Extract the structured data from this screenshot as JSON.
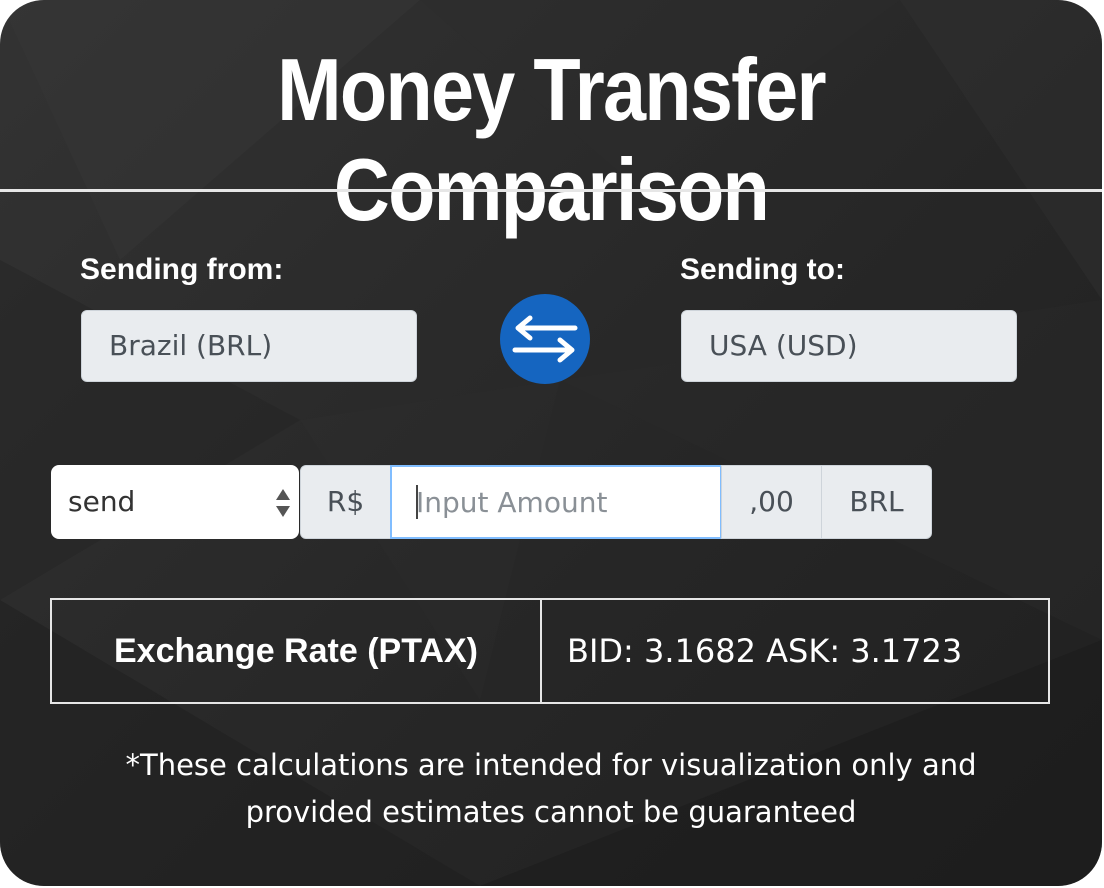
{
  "title": "Money Transfer Comparison",
  "from": {
    "label": "Sending from:",
    "value": "Brazil (BRL)"
  },
  "to": {
    "label": "Sending to:",
    "value": "USA (USD)"
  },
  "swap": {
    "icon": "swap-arrows-icon"
  },
  "amount": {
    "mode": "send",
    "prefix": "R$",
    "placeholder": "Input Amount",
    "decimals": ",00",
    "currency": "BRL"
  },
  "rate": {
    "label": "Exchange Rate (PTAX)",
    "value": "BID: 3.1682 ASK: 3.1723"
  },
  "disclaimer": {
    "line1": "*These calculations are intended for visualization only and",
    "line2": "provided estimates cannot be guaranteed"
  },
  "colors": {
    "accent": "#1565c0",
    "focus_border": "#80bdff",
    "addon_bg": "#e9ecef"
  }
}
